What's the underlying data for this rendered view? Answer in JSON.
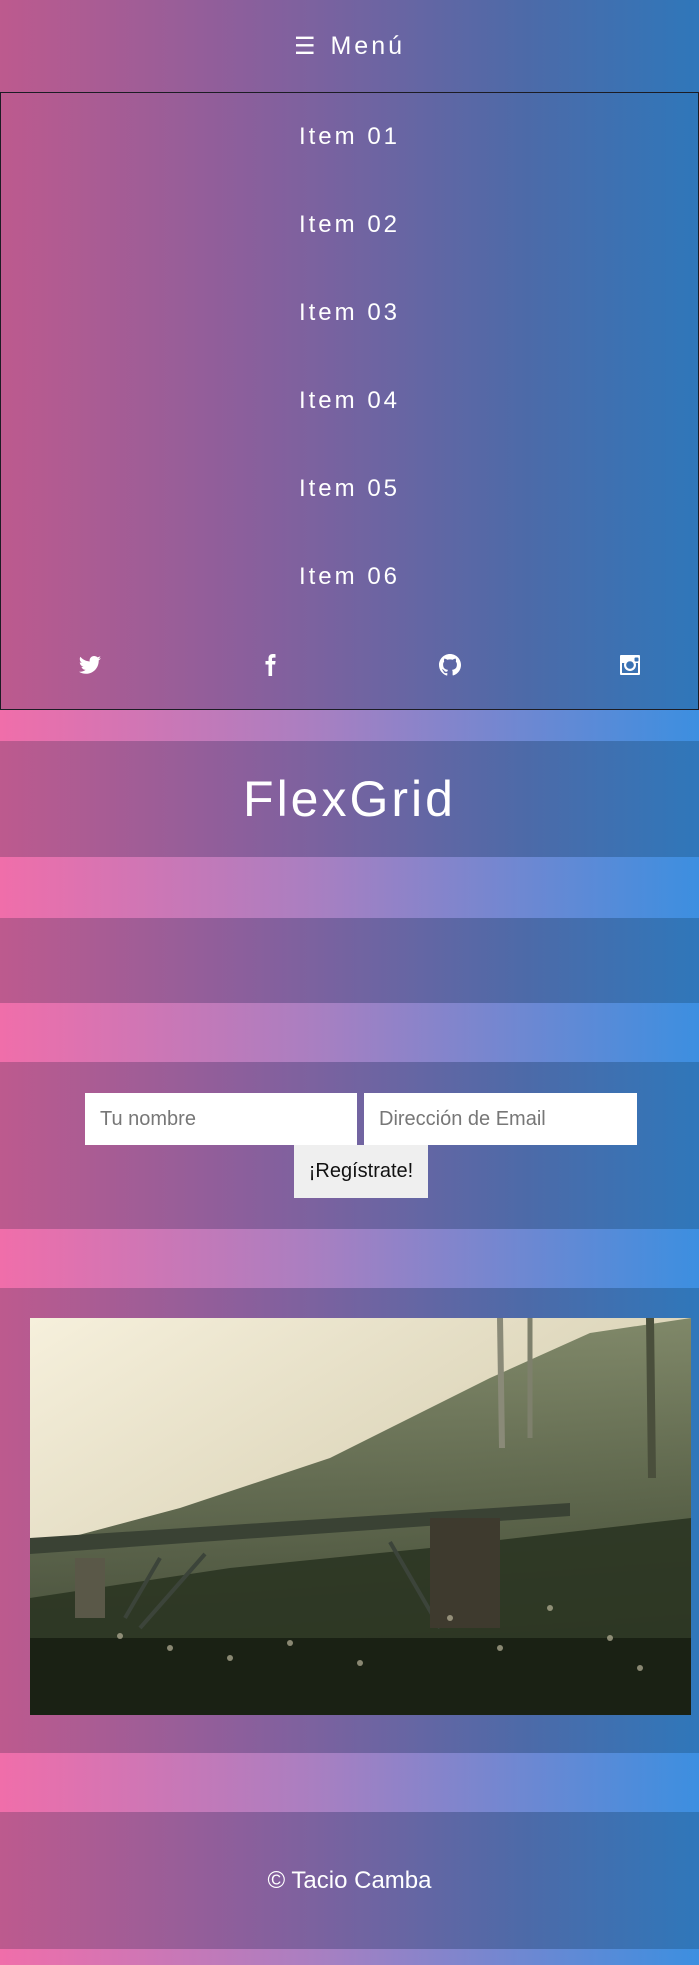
{
  "menu": {
    "icon": "hamburger-icon",
    "burger": "☰",
    "label": "Menú"
  },
  "nav": {
    "items": [
      {
        "label": "Item 01"
      },
      {
        "label": "Item 02"
      },
      {
        "label": "Item 03"
      },
      {
        "label": "Item 04"
      },
      {
        "label": "Item 05"
      },
      {
        "label": "Item 06"
      }
    ],
    "social": [
      "twitter-icon",
      "facebook-icon",
      "github-icon",
      "instagram-icon"
    ]
  },
  "hero": {
    "title": "FlexGrid"
  },
  "signup": {
    "name_placeholder": "Tu nombre",
    "email_placeholder": "Dirección de Email",
    "button_label": "¡Regístrate!"
  },
  "footer": {
    "text": "© Tacio Camba"
  },
  "colors": {
    "band_left": "#bd5a8e",
    "band_right": "#2f77ba",
    "stripe_left": "#f06eaa",
    "stripe_right": "#3c8fe0"
  }
}
